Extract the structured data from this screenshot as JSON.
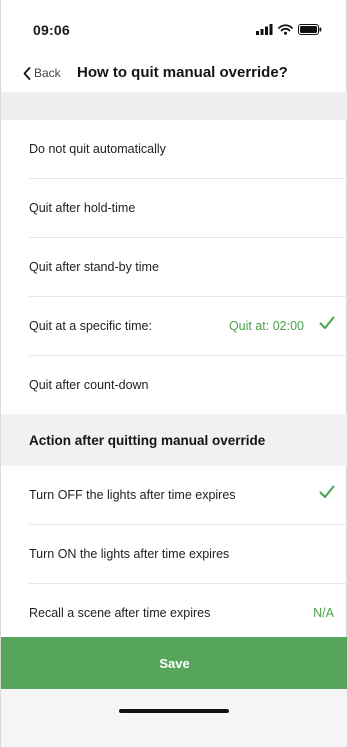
{
  "status_bar": {
    "time": "09:06",
    "icons": [
      "signal-icon",
      "wifi-icon",
      "battery-icon"
    ]
  },
  "nav": {
    "back_label": "Back",
    "title": "How to quit manual override?"
  },
  "quit_options": [
    {
      "label": "Do not quit automatically",
      "value": "",
      "selected": false
    },
    {
      "label": "Quit after hold-time",
      "value": "",
      "selected": false
    },
    {
      "label": "Quit after stand-by time",
      "value": "",
      "selected": false
    },
    {
      "label": "Quit at a specific time:",
      "value": "Quit at: 02:00",
      "selected": true
    },
    {
      "label": "Quit after count-down",
      "value": "",
      "selected": false
    }
  ],
  "action_section": {
    "title": "Action after quitting manual override",
    "options": [
      {
        "label": "Turn OFF the lights after time expires",
        "value": "",
        "selected": true
      },
      {
        "label": "Turn ON the lights after time expires",
        "value": "",
        "selected": false
      },
      {
        "label": "Recall a scene after time expires",
        "value": "N/A",
        "selected": false
      }
    ]
  },
  "save_label": "Save",
  "colors": {
    "accent": "#4aa14e",
    "save_button": "#57a55a",
    "section_background": "#f1f1f1"
  }
}
